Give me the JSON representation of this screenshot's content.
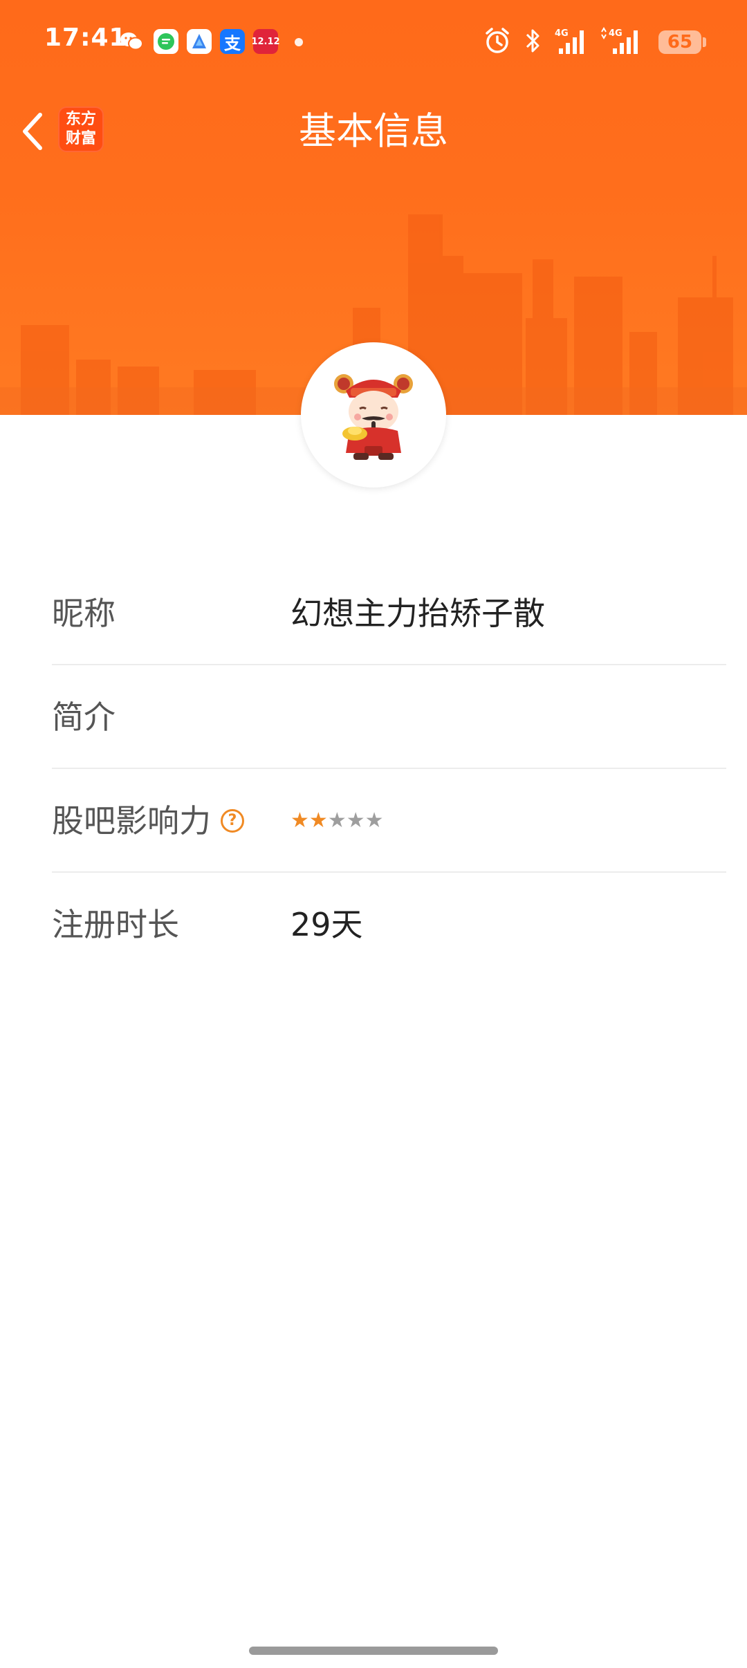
{
  "status_bar": {
    "time": "17:41",
    "battery": "65",
    "notification_icons": [
      {
        "name": "wechat-icon",
        "glyph": "✉",
        "bg": "transparent",
        "fg": "#ffffff"
      },
      {
        "name": "messages-icon",
        "glyph": "≡",
        "bg": "#ffffff",
        "fg": "#2ec55a"
      },
      {
        "name": "browser-icon",
        "glyph": "◆",
        "bg": "#ffffff",
        "fg": "#3a86f0"
      },
      {
        "name": "alipay-icon",
        "glyph": "支",
        "bg": "#1677ff",
        "fg": "#ffffff"
      },
      {
        "name": "taobao-1212-icon",
        "glyph": "12.12",
        "bg": "#e0243a",
        "fg": "#ffffff"
      }
    ]
  },
  "nav": {
    "logo_line1": "东方",
    "logo_line2": "财富",
    "title": "基本信息"
  },
  "profile": {
    "rows": [
      {
        "label": "昵称",
        "value": "幻想主力抬矫子散"
      },
      {
        "label": "简介",
        "value": ""
      },
      {
        "label": "股吧影响力",
        "value": "",
        "stars_filled": 2,
        "stars_total": 5
      },
      {
        "label": "注册时长",
        "value": "29天"
      }
    ],
    "help_glyph": "?"
  },
  "colors": {
    "header_orange": "#ff6a1a",
    "star_active": "#f08a24",
    "star_inactive": "#9e9e9e"
  }
}
